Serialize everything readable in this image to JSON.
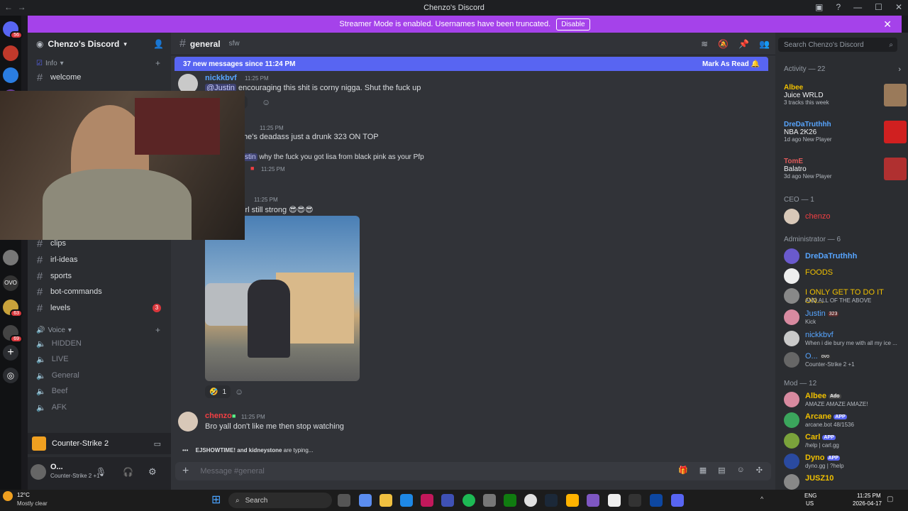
{
  "window": {
    "title": "Chenzo's Discord"
  },
  "banner": {
    "text": "Streamer Mode is enabled. Usernames have been truncated.",
    "disable_label": "Disable"
  },
  "servers": [
    {
      "badge": "56"
    },
    {
      "badge": ""
    },
    {
      "badge": ""
    },
    {
      "badge": "63"
    },
    {
      "badge": "69"
    }
  ],
  "sidebar": {
    "guild_name": "Chenzo's Discord",
    "category_info": "Info",
    "channels_top": [
      {
        "name": "welcome"
      }
    ],
    "channels_bottom": [
      {
        "name": "clips",
        "unread": ""
      },
      {
        "name": "irl-ideas",
        "unread": ""
      },
      {
        "name": "sports",
        "unread": ""
      },
      {
        "name": "bot-commands",
        "unread": ""
      },
      {
        "name": "levels",
        "unread": "3"
      }
    ],
    "category_voice": "Voice",
    "voice_channels": [
      "HIDDEN",
      "LIVE",
      "General",
      "Beef",
      "AFK"
    ],
    "game_bar": "Counter-Strike 2",
    "user": {
      "name": "O...",
      "status": "Counter-Strike 2 +1"
    }
  },
  "chat": {
    "channel_name": "general",
    "topic": "sfw",
    "new_messages_text": "37 new messages since 11:24 PM",
    "mark_as_read": "Mark As Read",
    "messages": [
      {
        "user": "nickkbvf",
        "time": "11:25 PM",
        "mention": "@Justin",
        "text": "encouraging this shit is corny nigga. Shut the fuck up",
        "reaction_count": "1"
      },
      {
        "time": "11:25 PM",
        "text": "he's deadass just a drunk 323 ON TOP"
      },
      {
        "mention": "stin",
        "text": "why the fuck you got lisa from black pink as your Pfp"
      },
      {
        "time": "11:25 PM"
      },
      {
        "time": "11:25 PM",
        "text": "irl still strong 😎😎😎",
        "reaction_count": "1"
      },
      {
        "user": "chenzo",
        "time": "11:25 PM",
        "text": "Bro yall don't like me then stop watching"
      }
    ],
    "typing": {
      "users": "EJSHOWTIME! and kidneystone",
      "suffix": " are typing..."
    },
    "input_placeholder": "Message #general"
  },
  "right": {
    "search_placeholder": "Search Chenzo's Discord",
    "activity_label": "Activity — 22",
    "activities": [
      {
        "name": "Albee",
        "title": "Juice WRLD",
        "sub": "3 tracks this week",
        "color": "#f0c000"
      },
      {
        "name": "DreDaTruthhh",
        "title": "NBA 2K26",
        "sub": "1d ago  New Player",
        "color": "#57a5ff"
      },
      {
        "name": "TomE",
        "title": "Balatro",
        "sub": "3d ago  New Player",
        "color": "#e05a5a"
      }
    ],
    "sections": [
      {
        "label": "CEO — 1",
        "members": [
          {
            "name": "chenzo",
            "status": "",
            "color": "#f23f43"
          }
        ]
      },
      {
        "label": "Administrator — 6",
        "members": [
          {
            "name": "DreDaTruthhh",
            "status": "",
            "color": "#57a5ff"
          },
          {
            "name": "FOODS",
            "status": "",
            "color": "#f0c000"
          },
          {
            "name": "I ONLY GET TO DO IT ON...",
            "status": "AND ALL OF THE ABOVE",
            "color": "#f0c000"
          },
          {
            "name": "Justin",
            "status": "Kick",
            "tag": "323",
            "color": "#57a5ff"
          },
          {
            "name": "nickkbvf",
            "status": "When i die bury me with all my ice ...",
            "color": "#57a5ff"
          },
          {
            "name": "O...",
            "status": "Counter-Strike 2 +1",
            "tag": "ovo",
            "color": "#57a5ff"
          }
        ]
      },
      {
        "label": "Mod — 12",
        "members": [
          {
            "name": "Albee",
            "status": "AMAZE AMAZE AMAZE!",
            "tag": "Ado",
            "color": "#f0c000"
          },
          {
            "name": "Arcane",
            "status": "arcane.bot 48/1536",
            "tag": "APP",
            "color": "#f0c000"
          },
          {
            "name": "Carl",
            "status": "/help | carl.gg",
            "tag": "APP",
            "color": "#f0c000"
          },
          {
            "name": "Dyno",
            "status": "dyno.gg | ?help",
            "tag": "APP",
            "color": "#f0c000"
          },
          {
            "name": "JUSZ10",
            "status": "",
            "color": "#f0c000"
          }
        ]
      }
    ]
  },
  "taskbar": {
    "weather_temp": "12°C",
    "weather_desc": "Mostly clear",
    "search_label": "Search",
    "lang": "ENG",
    "region": "US",
    "time": "11:25 PM",
    "date": "2026-04-17"
  },
  "colors": {
    "accent": "#5865f2",
    "banner": "#a542ea",
    "mention_red": "#da373c"
  }
}
